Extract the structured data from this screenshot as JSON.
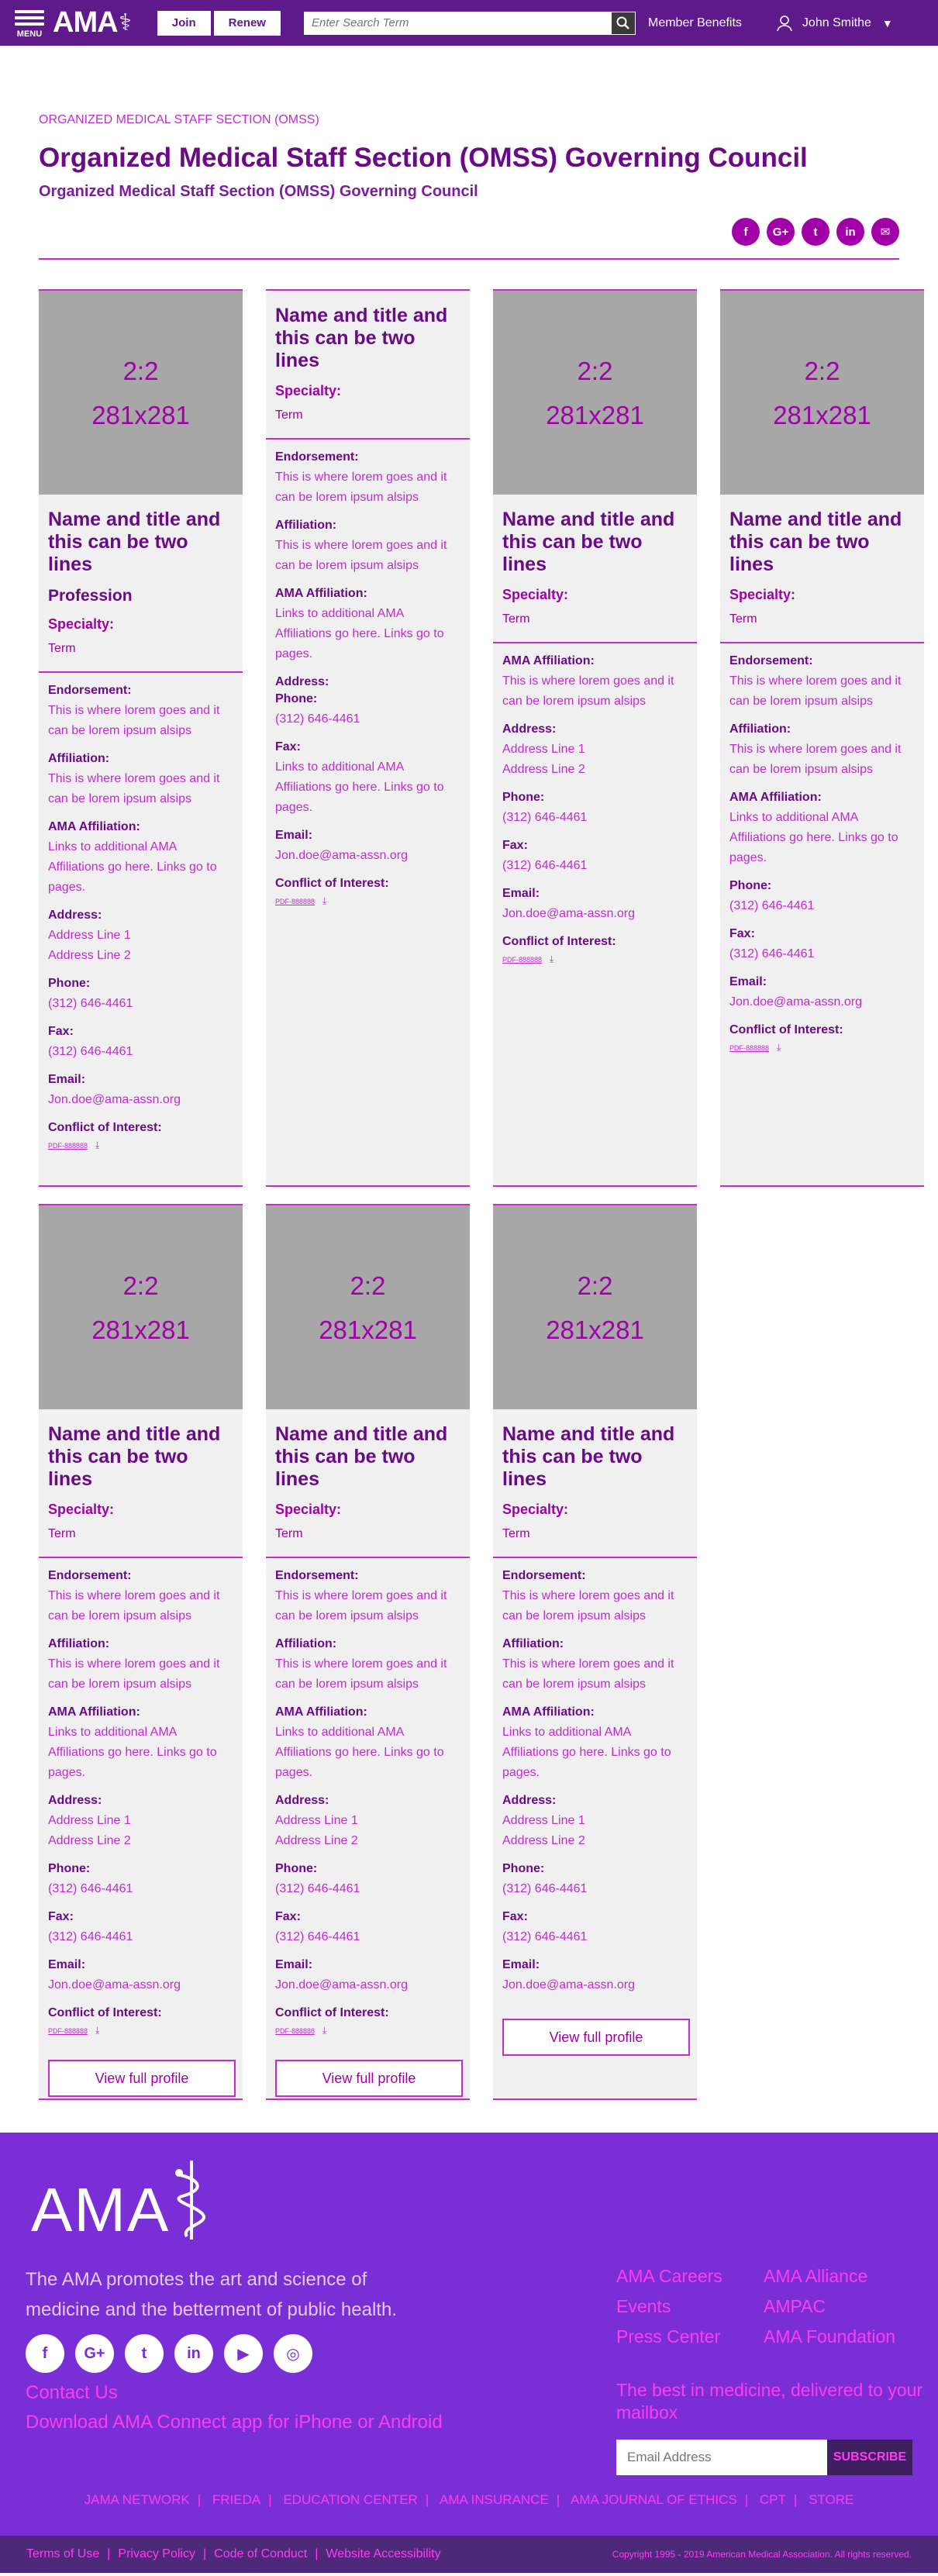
{
  "header": {
    "menu_label": "MENU",
    "logo": "AMA",
    "join": "Join",
    "renew": "Renew",
    "search_placeholder": "Enter Search Term",
    "member_benefits": "Member Benefits",
    "user_name": "John Smithe"
  },
  "page": {
    "breadcrumb": "ORGANIZED MEDICAL STAFF SECTION (OMSS)",
    "title": "Organized Medical Staff Section (OMSS) Governing Council",
    "subtitle": "Organized Medical Staff Section (OMSS) Governing Council"
  },
  "share_icons": [
    "facebook-icon",
    "google-plus-icon",
    "twitter-icon",
    "linkedin-icon",
    "email-icon"
  ],
  "labels": {
    "placeholder_ratio": "2:2",
    "placeholder_size": "281x281",
    "specialty": "Specialty:",
    "endorsement": "Endorsement:",
    "affiliation": "Affiliation:",
    "ama_affiliation": "AMA Affiliation:",
    "address": "Address:",
    "phone": "Phone:",
    "fax": "Fax:",
    "email": "Email:",
    "coi": "Conflict of Interest:",
    "view_full_profile": "View full profile",
    "coi_file": "PDF-888888"
  },
  "cards": [
    {
      "name": "Name and title and this can be two lines",
      "profession": "Profession",
      "specialty": "Term",
      "endorsement": "This is where lorem goes and it can be lorem ipsum alsips",
      "affiliation": "This is where lorem goes and it can be lorem ipsum alsips",
      "ama_affiliation": "Links to additional AMA Affiliations go here. Links go to pages.",
      "address1": "Address Line 1",
      "address2": "Address Line 2",
      "phone": "(312) 646-4461",
      "fax": "(312) 646-4461",
      "email": "Jon.doe@ama-assn.org"
    },
    {
      "name": "Name and title and this can be two lines",
      "specialty": "Term",
      "endorsement": "This is where lorem goes and it can be lorem ipsum alsips",
      "affiliation": "This is where lorem goes and it can be lorem ipsum alsips",
      "ama_affiliation": "Links to additional AMA Affiliations go here. Links go to pages.",
      "phone": "(312) 646-4461",
      "fax_text": "Links to additional AMA Affiliations go here. Links go to pages.",
      "email": "Jon.doe@ama-assn.org"
    },
    {
      "name": "Name and title and this can be two lines",
      "specialty": "Term",
      "ama_affiliation": "This is where lorem goes and it can be lorem ipsum alsips",
      "address1": "Address Line 1",
      "address2": "Address Line 2",
      "phone": "(312) 646-4461",
      "fax": "(312) 646-4461",
      "email": "Jon.doe@ama-assn.org"
    },
    {
      "name": "Name and title and this can be two lines",
      "specialty": "Term",
      "endorsement": "This is where lorem goes and it can be lorem ipsum alsips",
      "affiliation": "This is where lorem goes and it can be lorem ipsum alsips",
      "ama_affiliation": "Links to additional AMA Affiliations go here. Links go to pages.",
      "phone": "(312) 646-4461",
      "fax": "(312) 646-4461",
      "email": "Jon.doe@ama-assn.org"
    },
    {
      "name": "Name and title and this can be two lines",
      "specialty": "Term",
      "endorsement": "This is where lorem goes and it can be lorem ipsum alsips",
      "affiliation": "This is where lorem goes and it can be lorem ipsum alsips",
      "ama_affiliation": "Links to additional AMA Affiliations go here. Links go to pages.",
      "address1": "Address Line 1",
      "address2": "Address Line 2",
      "phone": "(312) 646-4461",
      "fax": "(312) 646-4461",
      "email": "Jon.doe@ama-assn.org"
    },
    {
      "name": "Name and title and this can be two lines",
      "specialty": "Term",
      "endorsement": "This is where lorem goes and it can be lorem ipsum alsips",
      "affiliation": "This is where lorem goes and it can be lorem ipsum alsips",
      "ama_affiliation": "Links to additional AMA Affiliations go here. Links go to pages.",
      "address1": "Address Line 1",
      "address2": "Address Line 2",
      "phone": "(312) 646-4461",
      "fax": "(312) 646-4461",
      "email": "Jon.doe@ama-assn.org"
    },
    {
      "name": "Name and title and this can be two lines",
      "specialty": "Term",
      "endorsement": "This is where lorem goes and it can be lorem ipsum alsips",
      "affiliation": "This is where lorem goes and it can be lorem ipsum alsips",
      "ama_affiliation": "Links to additional AMA Affiliations go here. Links go to pages.",
      "address1": "Address Line 1",
      "address2": "Address Line 2",
      "phone": "(312) 646-4461",
      "fax": "(312) 646-4461",
      "email": "Jon.doe@ama-assn.org"
    }
  ],
  "footer": {
    "logo": "AMA",
    "tagline": "The AMA promotes the art and science of medicine and the betterment of public health.",
    "social_icons": [
      "facebook-icon",
      "google-plus-icon",
      "twitter-icon",
      "linkedin-icon",
      "youtube-icon",
      "instagram-icon"
    ],
    "contact": "Contact Us",
    "app": "Download AMA Connect app for iPhone or Android",
    "links": [
      "AMA Careers",
      "AMA Alliance",
      "Events",
      "AMPAC",
      "Press Center",
      "AMA Foundation"
    ],
    "newsletter": "The best in medicine, delivered to your mailbox",
    "email_placeholder": "Email Address",
    "subscribe": "SUBSCRIBE",
    "bar_links": [
      "JAMA NETWORK",
      "FRIEDA",
      "EDUCATION CENTER",
      "AMA INSURANCE",
      "AMA JOURNAL OF ETHICS",
      "CPT",
      "STORE"
    ],
    "bottom_links": [
      "Terms of Use",
      "Privacy Policy",
      "Code of Conduct",
      "Website Accessibility"
    ],
    "copyright": "Copyright 1995 - 2019 American Medical Association. All rights reserved."
  }
}
